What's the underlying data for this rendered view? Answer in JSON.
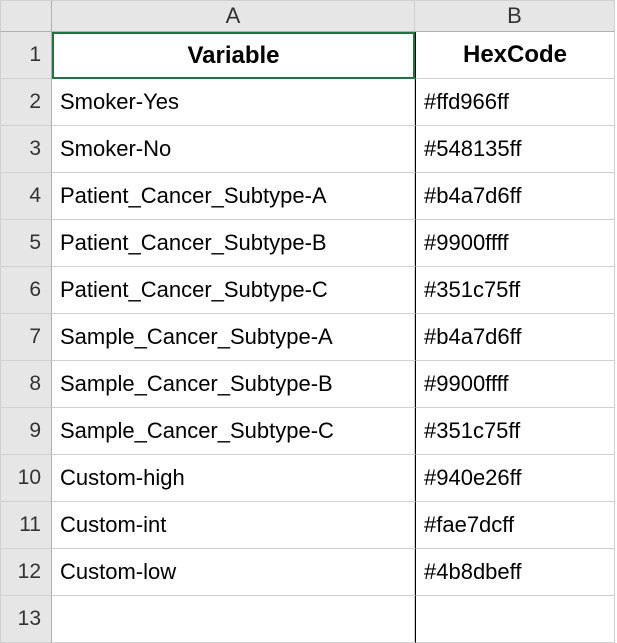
{
  "columns": {
    "A": "A",
    "B": "B"
  },
  "headers": {
    "variable": "Variable",
    "hexcode": "HexCode"
  },
  "rows": [
    {
      "num": "1"
    },
    {
      "num": "2",
      "variable": "Smoker-Yes",
      "hexcode": "#ffd966ff"
    },
    {
      "num": "3",
      "variable": "Smoker-No",
      "hexcode": "#548135ff"
    },
    {
      "num": "4",
      "variable": "Patient_Cancer_Subtype-A",
      "hexcode": "#b4a7d6ff"
    },
    {
      "num": "5",
      "variable": "Patient_Cancer_Subtype-B",
      "hexcode": "#9900ffff"
    },
    {
      "num": "6",
      "variable": "Patient_Cancer_Subtype-C",
      "hexcode": "#351c75ff"
    },
    {
      "num": "7",
      "variable": "Sample_Cancer_Subtype-A",
      "hexcode": "#b4a7d6ff"
    },
    {
      "num": "8",
      "variable": "Sample_Cancer_Subtype-B",
      "hexcode": "#9900ffff"
    },
    {
      "num": "9",
      "variable": "Sample_Cancer_Subtype-C",
      "hexcode": "#351c75ff"
    },
    {
      "num": "10",
      "variable": "Custom-high",
      "hexcode": "#940e26ff"
    },
    {
      "num": "11",
      "variable": "Custom-int",
      "hexcode": "#fae7dcff"
    },
    {
      "num": "12",
      "variable": "Custom-low",
      "hexcode": "#4b8dbeff"
    },
    {
      "num": "13",
      "variable": "",
      "hexcode": ""
    }
  ]
}
